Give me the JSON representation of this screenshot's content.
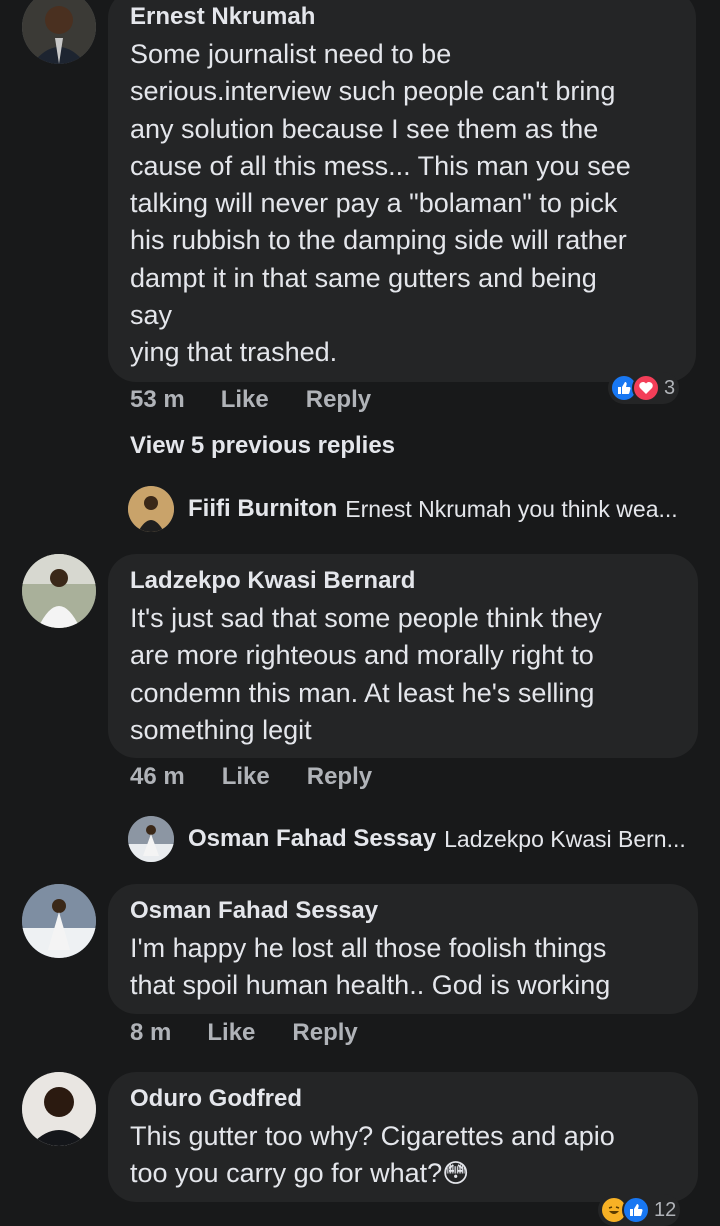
{
  "comments": [
    {
      "author": "Ernest Nkrumah",
      "text": "Some journalist need to be\nserious.interview such people can't bring\nany solution because I see them as the\ncause of all this mess... This man you see\ntalking will never pay a \"bolaman\" to pick\nhis rubbish to the damping side will rather\ndampt it in that same gutters and being\nsay\nying that trashed.",
      "time": "53 m",
      "like": "Like",
      "reply": "Reply",
      "reactions": {
        "icons": [
          "like-icon",
          "love-icon"
        ],
        "count": "3"
      }
    },
    {
      "author": "Ladzekpo Kwasi Bernard",
      "text": "It's just sad that some people think they\nare more righteous and morally right to\ncondemn this man. At least he's selling\nsomething legit",
      "time": "46 m",
      "like": "Like",
      "reply": "Reply"
    },
    {
      "author": "Osman Fahad Sessay",
      "text": "I'm happy he lost all those foolish things\nthat spoil human health.. God is working",
      "time": "8 m",
      "like": "Like",
      "reply": "Reply"
    },
    {
      "author": "Oduro Godfred",
      "text": "This gutter too why? Cigarettes and apio\ntoo you carry go for what?",
      "emoji": "😳",
      "reactions": {
        "icons": [
          "haha-icon",
          "like-icon"
        ],
        "count": "12"
      }
    }
  ],
  "view_previous": "View 5 previous replies",
  "replies": [
    {
      "author": "Fiifi Burniton",
      "preview": "Ernest Nkrumah you think wea..."
    },
    {
      "author": "Osman Fahad Sessay",
      "preview": "Ladzekpo Kwasi Bern..."
    }
  ],
  "colors": {
    "background": "#18191a",
    "bubble": "#242526",
    "text": "#e4e6eb",
    "secondary": "#b0b3b8",
    "like_blue": "#1877f2",
    "love_red": "#f33e58"
  }
}
